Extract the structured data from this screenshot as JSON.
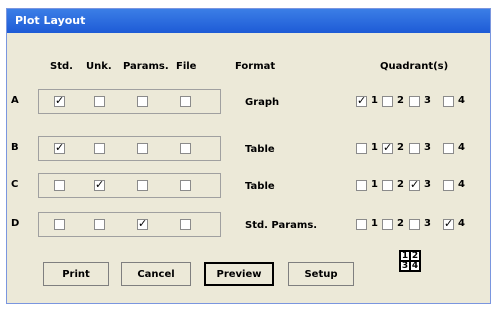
{
  "window": {
    "title": "Plot Layout"
  },
  "headers": {
    "std": "Std.",
    "unk": "Unk.",
    "params": "Params.",
    "file": "File",
    "format": "Format",
    "quadrants": "Quadrant(s)"
  },
  "rows": [
    {
      "label": "A",
      "std": true,
      "unk": false,
      "params": false,
      "file": false,
      "format": "Graph",
      "quadrant": 1
    },
    {
      "label": "B",
      "std": true,
      "unk": false,
      "params": false,
      "file": false,
      "format": "Table",
      "quadrant": 2
    },
    {
      "label": "C",
      "std": false,
      "unk": true,
      "params": false,
      "file": false,
      "format": "Table",
      "quadrant": 3
    },
    {
      "label": "D",
      "std": false,
      "unk": false,
      "params": true,
      "file": false,
      "format": "Std. Params.",
      "quadrant": 4
    }
  ],
  "quadrant_numbers": [
    "1",
    "2",
    "3",
    "4"
  ],
  "buttons": {
    "print": "Print",
    "cancel": "Cancel",
    "preview": "Preview",
    "setup": "Setup"
  },
  "quad_icon": [
    "1",
    "2",
    "3",
    "4"
  ],
  "colors": {
    "titlebar": "#1e5bd6",
    "dialog_bg": "#ece9d8"
  }
}
